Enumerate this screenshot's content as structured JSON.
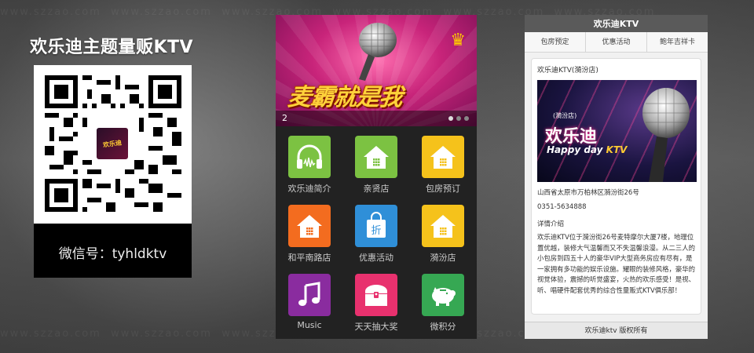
{
  "promo": {
    "title": "欢乐迪主题量贩KTV",
    "wechat_id": "微信号：tyhldktv",
    "qr_logo_text": "欢乐迪"
  },
  "phone_menu": {
    "banner": {
      "slogan": "麦霸就是我",
      "slide_number": "2"
    },
    "tiles": [
      {
        "label": "欢乐迪简介",
        "icon": "headphones-icon",
        "color": "#7cc242"
      },
      {
        "label": "亲贤店",
        "icon": "home-icon",
        "color": "#7cc242"
      },
      {
        "label": "包房预订",
        "icon": "home-icon",
        "color": "#f5c21b"
      },
      {
        "label": "和平南路店",
        "icon": "home-icon",
        "color": "#f36c1f"
      },
      {
        "label": "优惠活动",
        "icon": "discount-bag-icon",
        "color": "#2f8fd8"
      },
      {
        "label": "漪汾店",
        "icon": "home-icon",
        "color": "#f5c21b"
      },
      {
        "label": "Music",
        "icon": "music-note-icon",
        "color": "#8a2c9f"
      },
      {
        "label": "天天抽大奖",
        "icon": "treasure-chest-icon",
        "color": "#e8316e"
      },
      {
        "label": "微积分",
        "icon": "piggy-bank-icon",
        "color": "#36a853"
      }
    ]
  },
  "phone_detail": {
    "header_title": "欢乐迪KTV",
    "tabs": [
      "包房预定",
      "优惠活动",
      "鲍年吉祥卡"
    ],
    "store_name": "欢乐迪KTV(漪汾店)",
    "photo": {
      "branch": "(漪汾店)",
      "brand": "欢乐迪",
      "slogan_a": "Happy day ",
      "slogan_b": "KTV"
    },
    "address": "山西省太原市万柏林区漪汾街26号",
    "phone": "0351-5634888",
    "details_label": "详情介绍",
    "description": "欢乐迪KTV位于漪汾街26号麦特摩尔大厦7楼，地理位置优越，装修大气温馨而又不失温馨浪漫。从二三人的小包房到四五十人的豪华VIP大型商务房应有尽有，是一家拥有多功能的娱乐设施。耀眼的装修风格，豪华的视觉体验，震撼的听觉盛宴，火热的欢乐感受！是视、听、唱硬件配套优秀的综合性量贩式KTV俱乐部！",
    "footer": "欢乐迪ktv 版权所有"
  }
}
